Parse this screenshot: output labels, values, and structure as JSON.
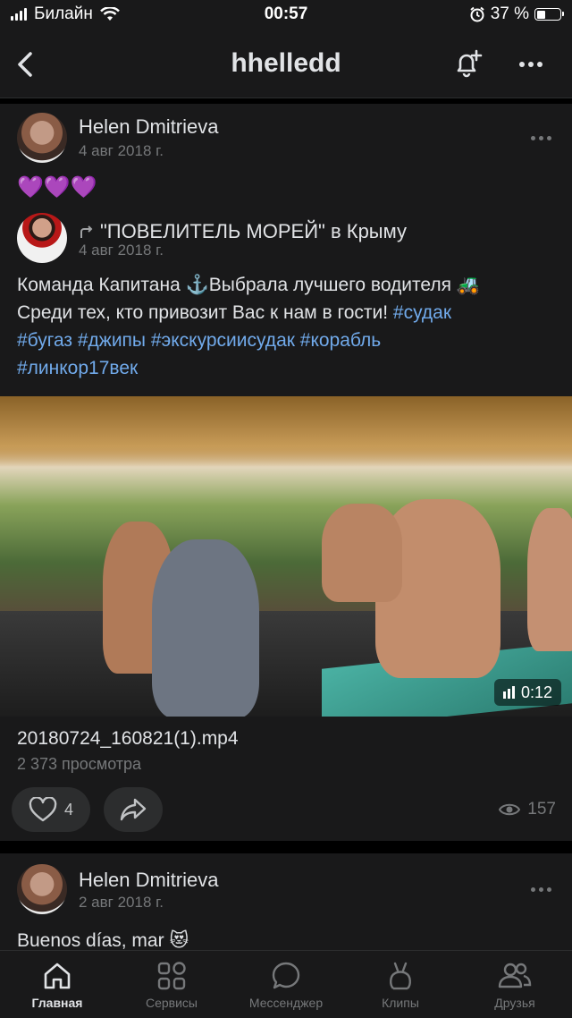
{
  "status_bar": {
    "carrier": "Билайн",
    "time": "00:57",
    "battery_percent_label": "37 %",
    "battery_level": 0.37
  },
  "header": {
    "title": "hhelledd"
  },
  "post1": {
    "author": "Helen Dmitrieva",
    "date": "4 авг 2018 г.",
    "text": "💜💜💜",
    "repost": {
      "author": "\"ПОВЕЛИТЕЛЬ МОРЕЙ\" в Крыму",
      "date": "4 авг 2018 г.",
      "text_line1": "Команда Капитана ⚓️Выбрала лучшего водителя 🚜",
      "text_line2_plain": "Среди тех, кто привозит Вас к нам в гости! ",
      "text_line2_tag": "#судак",
      "hashtags_line3": "#бугаз #джипы #экскурсиисудак #корабль",
      "hashtags_line4": "#линкор17век"
    },
    "video": {
      "duration": "0:12",
      "title": "20180724_160821(1).mp4",
      "views": "2 373 просмотра"
    },
    "likes": "4",
    "views": "157"
  },
  "post2": {
    "author": "Helen Dmitrieva",
    "date": "2 авг 2018 г.",
    "text": "Buenos días, mar 😻"
  },
  "tabbar": {
    "items": [
      {
        "label": "Главная",
        "icon": "home-icon",
        "active": true
      },
      {
        "label": "Сервисы",
        "icon": "services-icon",
        "active": false
      },
      {
        "label": "Мессенджер",
        "icon": "messenger-icon",
        "active": false
      },
      {
        "label": "Клипы",
        "icon": "clips-icon",
        "active": false
      },
      {
        "label": "Друзья",
        "icon": "friends-icon",
        "active": false
      }
    ]
  },
  "colors": {
    "background": "#000000",
    "card": "#19191a",
    "text": "#e1e3e6",
    "secondary": "#76787a",
    "hashtag": "#71aaeb"
  }
}
